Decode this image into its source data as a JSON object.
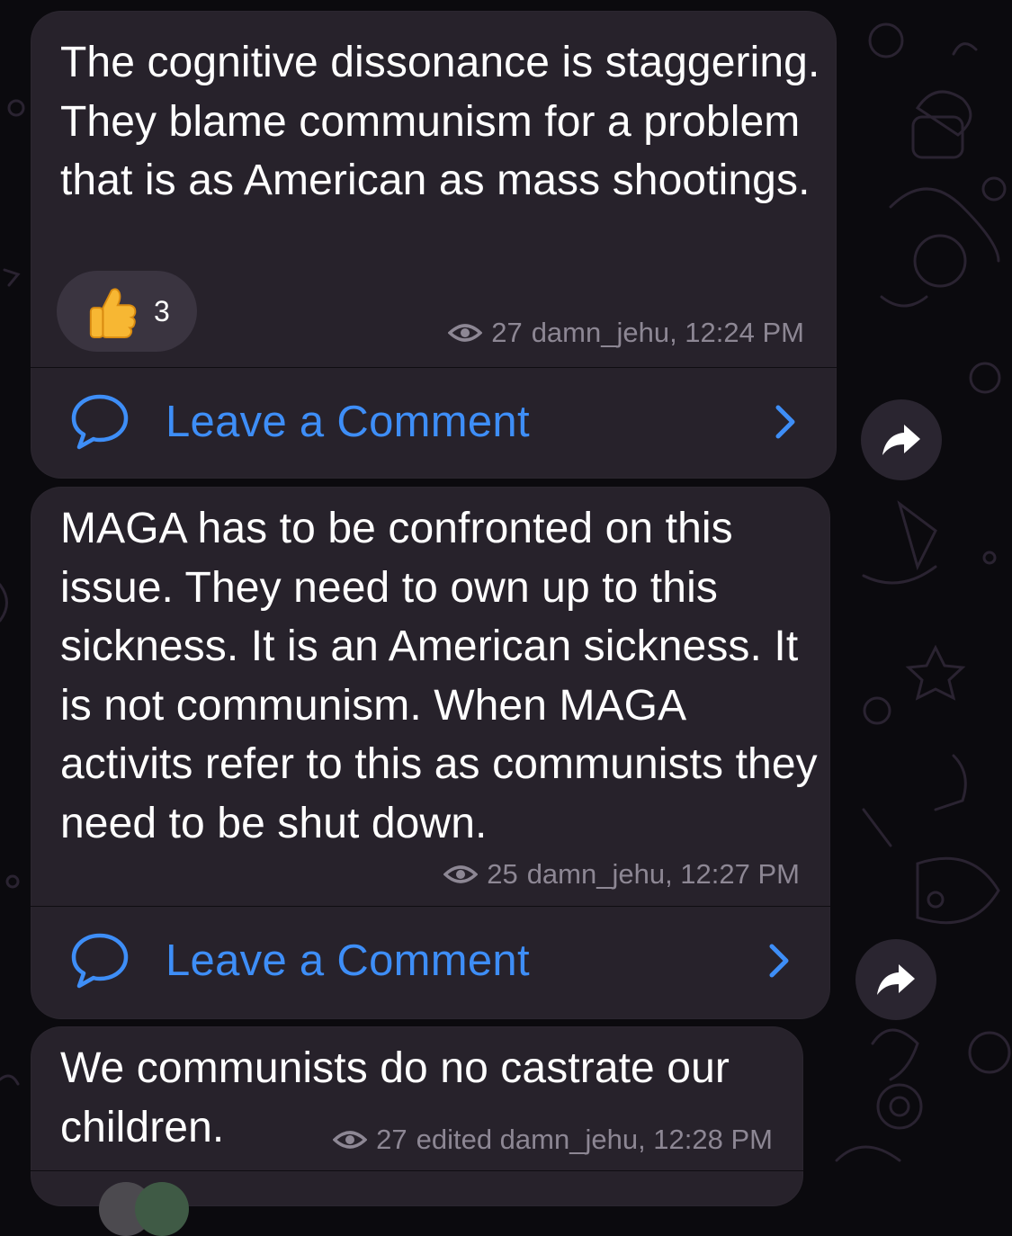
{
  "colors": {
    "background": "#0b0a0e",
    "bubble": "#27222b",
    "text": "#ffffff",
    "meta": "#8d8794",
    "accent": "#3e8ef7",
    "reaction_pill": "#3a3440"
  },
  "messages": [
    {
      "text": "The cognitive dissonance is staggering. They blame communism for a problem that is as American as mass shootings.",
      "views": "27",
      "author": "damn_jehu",
      "time": "12:24 PM",
      "meta_text": "damn_jehu, 12:24 PM",
      "reaction": {
        "emoji_icon": "thumbs-up-icon",
        "count": "3"
      },
      "comment_label": "Leave a Comment"
    },
    {
      "text": "MAGA has to be confronted on this issue. They need to own up to this sickness. It is an American sickness. It is not communism. When MAGA activits refer to this as communists they need to be shut down.",
      "views": "25",
      "author": "damn_jehu",
      "time": "12:27 PM",
      "meta_text": "damn_jehu, 12:27 PM",
      "comment_label": "Leave a Comment"
    },
    {
      "text": "We communists do no castrate our children.",
      "views": "27",
      "edited": "edited",
      "author": "damn_jehu",
      "time": "12:28 PM",
      "meta_text": "edited damn_jehu, 12:28 PM"
    }
  ],
  "icons": {
    "views": "eye-icon",
    "comment": "speech-bubble-icon",
    "chevron": "chevron-right-icon",
    "share": "share-arrow-icon"
  }
}
